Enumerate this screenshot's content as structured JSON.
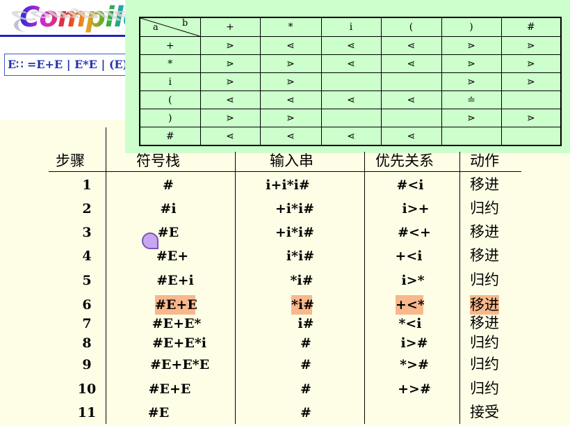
{
  "logo": {
    "text": "Compiler"
  },
  "grammar": "E∷ =E+E | E*E | (E) | i",
  "matrix": {
    "corner_row": "a",
    "corner_col": "b",
    "col_headers": [
      "+",
      "*",
      "i",
      "(",
      ")",
      "#"
    ],
    "rows": [
      {
        "head": "+",
        "cells": [
          "⋗",
          "⋖",
          "⋖",
          "⋖",
          "⋗",
          "⋗"
        ]
      },
      {
        "head": "*",
        "cells": [
          "⋗",
          "⋗",
          "⋖",
          "⋖",
          "⋗",
          "⋗"
        ]
      },
      {
        "head": "i",
        "cells": [
          "⋗",
          "⋗",
          "",
          "",
          "⋗",
          "⋗"
        ]
      },
      {
        "head": "(",
        "cells": [
          "⋖",
          "⋖",
          "⋖",
          "⋖",
          "≐",
          ""
        ]
      },
      {
        "head": ")",
        "cells": [
          "⋗",
          "⋗",
          "",
          "",
          "⋗",
          "⋗"
        ]
      },
      {
        "head": "#",
        "cells": [
          "⋖",
          "⋖",
          "⋖",
          "⋖",
          "",
          ""
        ]
      }
    ]
  },
  "headers": {
    "step": "步骤",
    "stack": "符号栈",
    "input": "输入串",
    "relation": "优先关系",
    "action": "动作"
  },
  "rows": [
    {
      "step": "1",
      "stack": "#",
      "input": "i+i*i#",
      "relation": "#<i",
      "action": "移进"
    },
    {
      "step": "2",
      "stack": "#i",
      "input": "+i*i#",
      "relation": "i>+",
      "action": "归约"
    },
    {
      "step": "3",
      "stack": "#E",
      "input": "+i*i#",
      "relation": "#<+",
      "action": "移进"
    },
    {
      "step": "4",
      "stack": "#E+",
      "input": "i*i#",
      "relation": "+<i",
      "action": "移进"
    },
    {
      "step": "5",
      "stack": "#E+i",
      "input": "*i#",
      "relation": "i>*",
      "action": "归约"
    },
    {
      "step": "6",
      "stack": "#E+E",
      "input": "*i#",
      "relation": "+<*",
      "action": "移进"
    },
    {
      "step": "7",
      "stack": "#E+E*",
      "input": "i#",
      "relation": "*<i",
      "action": "移进"
    },
    {
      "step": "8",
      "stack": "#E+E*i",
      "input": "#",
      "relation": "i>#",
      "action": "归约"
    },
    {
      "step": "9",
      "stack": "#E+E*E",
      "input": "#",
      "relation": "*>#",
      "action": "归约"
    },
    {
      "step": "10",
      "stack": "#E+E",
      "input": "#",
      "relation": "+>#",
      "action": "归约"
    },
    {
      "step": "11",
      "stack": "#E",
      "input": "#",
      "relation": "",
      "action": "接受"
    }
  ],
  "colors": {
    "highlight": "#f8b88c",
    "panel": "#ccffcc",
    "background": "#fefee6"
  }
}
